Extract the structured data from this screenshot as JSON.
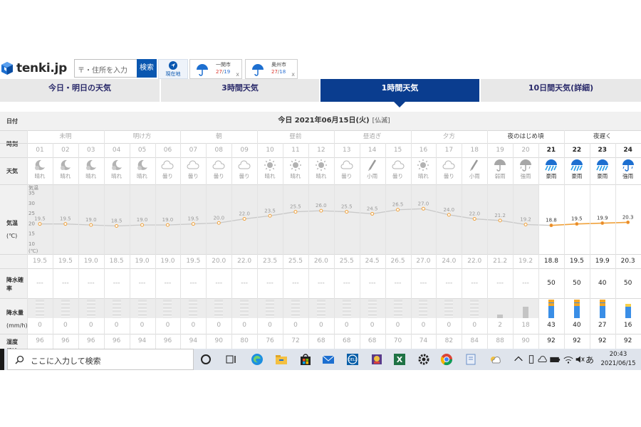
{
  "site": {
    "logo_text": "tenki.jp",
    "search_placeholder": "〒・住所を入力",
    "search_button": "検索",
    "current_location": "現在地",
    "chips": [
      {
        "city": "一関市",
        "high": "27",
        "low": "19",
        "close": "x"
      },
      {
        "city": "奥州市",
        "high": "27",
        "low": "18",
        "close": "x"
      }
    ]
  },
  "tabs": [
    {
      "label": "今日・明日の天気",
      "active": false
    },
    {
      "label": "3時間天気",
      "active": false
    },
    {
      "label": "1時間天気",
      "active": true
    },
    {
      "label": "10日間天気(詳細)",
      "active": false
    }
  ],
  "table": {
    "labels": {
      "date": "日付",
      "time": "時刻",
      "weather": "天気",
      "temp_line1": "気温",
      "temp_line2": "(℃)",
      "prob_line1": "降水確率",
      "prob_line2": "(%)",
      "amount_line1": "降水量",
      "amount_line2": "(mm/h)",
      "humidity": "湿度(%)"
    },
    "date_title": "今日 2021年06月15日(火)",
    "date_rokuyo": "[仏滅]",
    "periods": [
      "未明",
      "明け方",
      "朝",
      "昼前",
      "昼過ぎ",
      "夕方",
      "夜のはじめ頃",
      "夜遅く"
    ],
    "current_period_start": 6,
    "current_hour_index": 20,
    "axis_header": "気温",
    "axis_footer": "(℃)",
    "axis_ticks": [
      "35",
      "30",
      "25",
      "20",
      "15",
      "10"
    ],
    "precip_amount_unit_icon_colors": {
      "low": "#c4c4c4",
      "mid": "#3a8ee6",
      "high": "#f5a623"
    },
    "hours": [
      {
        "hour": "01",
        "weather": "晴れ",
        "icon": "moon-icon",
        "temp": "19.5",
        "prob": "---",
        "amount": "0",
        "humidity": "96"
      },
      {
        "hour": "02",
        "weather": "晴れ",
        "icon": "moon-icon",
        "temp": "19.5",
        "prob": "---",
        "amount": "0",
        "humidity": "96"
      },
      {
        "hour": "03",
        "weather": "晴れ",
        "icon": "moon-icon",
        "temp": "19.0",
        "prob": "---",
        "amount": "0",
        "humidity": "96"
      },
      {
        "hour": "04",
        "weather": "晴れ",
        "icon": "moon-icon",
        "temp": "18.5",
        "prob": "---",
        "amount": "0",
        "humidity": "96"
      },
      {
        "hour": "05",
        "weather": "晴れ",
        "icon": "moon-icon",
        "temp": "19.0",
        "prob": "---",
        "amount": "0",
        "humidity": "94"
      },
      {
        "hour": "06",
        "weather": "曇り",
        "icon": "cloud-icon",
        "temp": "19.0",
        "prob": "---",
        "amount": "0",
        "humidity": "96"
      },
      {
        "hour": "07",
        "weather": "曇り",
        "icon": "cloud-icon",
        "temp": "19.5",
        "prob": "---",
        "amount": "0",
        "humidity": "94"
      },
      {
        "hour": "08",
        "weather": "曇り",
        "icon": "cloud-icon",
        "temp": "20.0",
        "prob": "---",
        "amount": "0",
        "humidity": "90"
      },
      {
        "hour": "09",
        "weather": "曇り",
        "icon": "cloud-icon",
        "temp": "22.0",
        "prob": "---",
        "amount": "0",
        "humidity": "80"
      },
      {
        "hour": "10",
        "weather": "晴れ",
        "icon": "sun-icon",
        "temp": "23.5",
        "prob": "---",
        "amount": "0",
        "humidity": "76"
      },
      {
        "hour": "11",
        "weather": "晴れ",
        "icon": "sun-icon",
        "temp": "25.5",
        "prob": "---",
        "amount": "0",
        "humidity": "72"
      },
      {
        "hour": "12",
        "weather": "晴れ",
        "icon": "sun-icon",
        "temp": "26.0",
        "prob": "---",
        "amount": "0",
        "humidity": "68"
      },
      {
        "hour": "13",
        "weather": "曇り",
        "icon": "cloud-icon",
        "temp": "25.5",
        "prob": "---",
        "amount": "0",
        "humidity": "68"
      },
      {
        "hour": "14",
        "weather": "小雨",
        "icon": "umbrella-closed-icon",
        "temp": "24.5",
        "prob": "---",
        "amount": "0",
        "humidity": "68"
      },
      {
        "hour": "15",
        "weather": "曇り",
        "icon": "cloud-icon",
        "temp": "26.5",
        "prob": "---",
        "amount": "0",
        "humidity": "70"
      },
      {
        "hour": "16",
        "weather": "晴れ",
        "icon": "sun-icon",
        "temp": "27.0",
        "prob": "---",
        "amount": "0",
        "humidity": "74"
      },
      {
        "hour": "17",
        "weather": "曇り",
        "icon": "cloud-icon",
        "temp": "24.0",
        "prob": "---",
        "amount": "0",
        "humidity": "82"
      },
      {
        "hour": "18",
        "weather": "小雨",
        "icon": "umbrella-closed-icon",
        "temp": "22.0",
        "prob": "---",
        "amount": "0",
        "humidity": "84"
      },
      {
        "hour": "19",
        "weather": "弱雨",
        "icon": "umbrella-icon",
        "temp": "21.2",
        "prob": "---",
        "amount": "2",
        "humidity": "88",
        "amount_level": 0.2
      },
      {
        "hour": "20",
        "weather": "強雨",
        "icon": "umbrella-heavy-icon",
        "temp": "19.2",
        "prob": "---",
        "amount": "18",
        "humidity": "90",
        "amount_level": 0.6
      },
      {
        "hour": "21",
        "weather": "豪雨",
        "icon": "downpour-icon",
        "temp": "18.8",
        "prob": "50",
        "amount": "43",
        "humidity": "92",
        "amount_level": 1.0
      },
      {
        "hour": "22",
        "weather": "豪雨",
        "icon": "downpour-icon",
        "temp": "19.5",
        "prob": "50",
        "amount": "40",
        "humidity": "92",
        "amount_level": 1.0
      },
      {
        "hour": "23",
        "weather": "豪雨",
        "icon": "downpour-icon",
        "temp": "19.9",
        "prob": "40",
        "amount": "27",
        "humidity": "92",
        "amount_level": 1.0
      },
      {
        "hour": "24",
        "weather": "強雨",
        "icon": "umbrella-heavy-icon",
        "temp": "20.3",
        "prob": "50",
        "amount": "16",
        "humidity": "92",
        "amount_level": 0.8
      }
    ],
    "graph_labels": [
      "19.5",
      "19.5",
      "19.0",
      "18.5",
      "19.0",
      "19.0",
      "19.5",
      "20.0",
      "22.0",
      "23.5",
      "25.5",
      "26.0",
      "25.5",
      "24.5",
      "26.5",
      "27.0",
      "24.0",
      "22.0",
      "21.2",
      "19.2",
      "18.8",
      "19.5",
      "19.9",
      "20.3"
    ]
  },
  "taskbar": {
    "search_text": "ここに入力して検索",
    "icons": [
      "cortana-icon",
      "task-view-icon",
      "edge-icon",
      "file-explorer-icon",
      "store-icon",
      "mail-icon",
      "dell-icon",
      "game-icon",
      "excel-icon",
      "settings-icon",
      "chrome-icon",
      "notebook-icon",
      "weather-tray-icon"
    ],
    "tray_ime": "あ",
    "clock_time": "20:43",
    "clock_date": "2021/06/15"
  }
}
